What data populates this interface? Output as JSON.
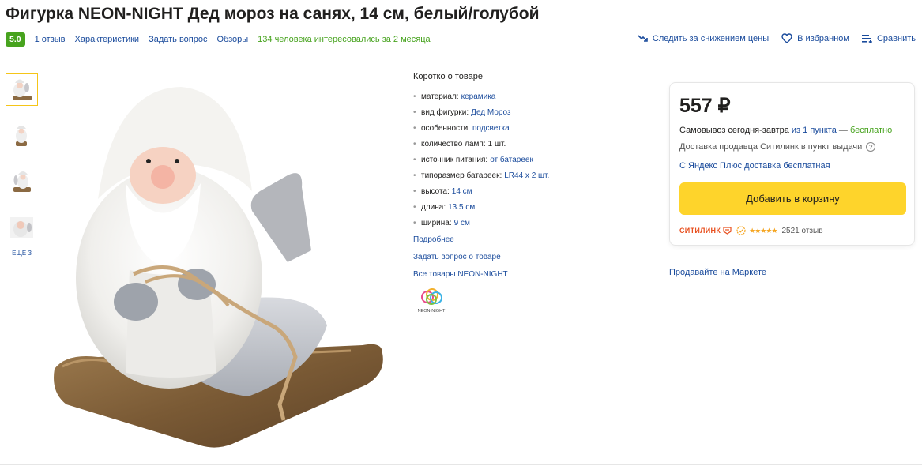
{
  "product": {
    "title": "Фигурка NEON-NIGHT Дед мороз на санях, 14 см, белый/голубой",
    "rating": "5.0",
    "reviews_link": "1 отзыв",
    "specs_link": "Характеристики",
    "ask_link": "Задать вопрос",
    "overviews_link": "Обзоры",
    "interest_text": "134 человека интересовались за 2 месяца"
  },
  "actions": {
    "track_price": "Следить за снижением цены",
    "favorite": "В избранном",
    "compare": "Сравнить"
  },
  "gallery": {
    "more_label": "ЕЩЁ 3"
  },
  "summary": {
    "title": "Коротко о товаре",
    "items": [
      {
        "key": "материал:",
        "value": "керамика"
      },
      {
        "key": "вид фигурки:",
        "value": "Дед Мороз"
      },
      {
        "key": "особенности:",
        "value": "подсветка"
      },
      {
        "key": "количество ламп:",
        "value": "1 шт."
      },
      {
        "key": "источник питания:",
        "value": "от батареек"
      },
      {
        "key": "типоразмер батареек:",
        "value": "LR44 x 2 шт."
      },
      {
        "key": "высота:",
        "value": "14 см"
      },
      {
        "key": "длина:",
        "value": "13.5 см"
      },
      {
        "key": "ширина:",
        "value": "9 см"
      }
    ],
    "more_link": "Подробнее",
    "ask_link": "Задать вопрос о товаре",
    "brand_link": "Все товары NEON-NIGHT",
    "brand_logo_text": "NEON-NIGHT"
  },
  "offer": {
    "price": "557 ₽",
    "pickup_prefix": "Самовывоз сегодня-завтра",
    "pickup_points": "из 1 пункта",
    "pickup_dash": "—",
    "pickup_cost": "бесплатно",
    "delivery_text": "Доставка продавца Ситилинк в пункт выдачи",
    "plus_delivery": "С Яндекс Плюс доставка бесплатная",
    "cart_button": "Добавить в корзину",
    "seller_name": "СИТИЛИНК",
    "stars": "★★★★★",
    "reviews": "2521 отзыв"
  },
  "sell_link": "Продавайте на Маркете",
  "colors": {
    "link": "#1a4b9c",
    "green": "#47a31e",
    "cart": "#fed42b",
    "seller": "#e8501f"
  }
}
